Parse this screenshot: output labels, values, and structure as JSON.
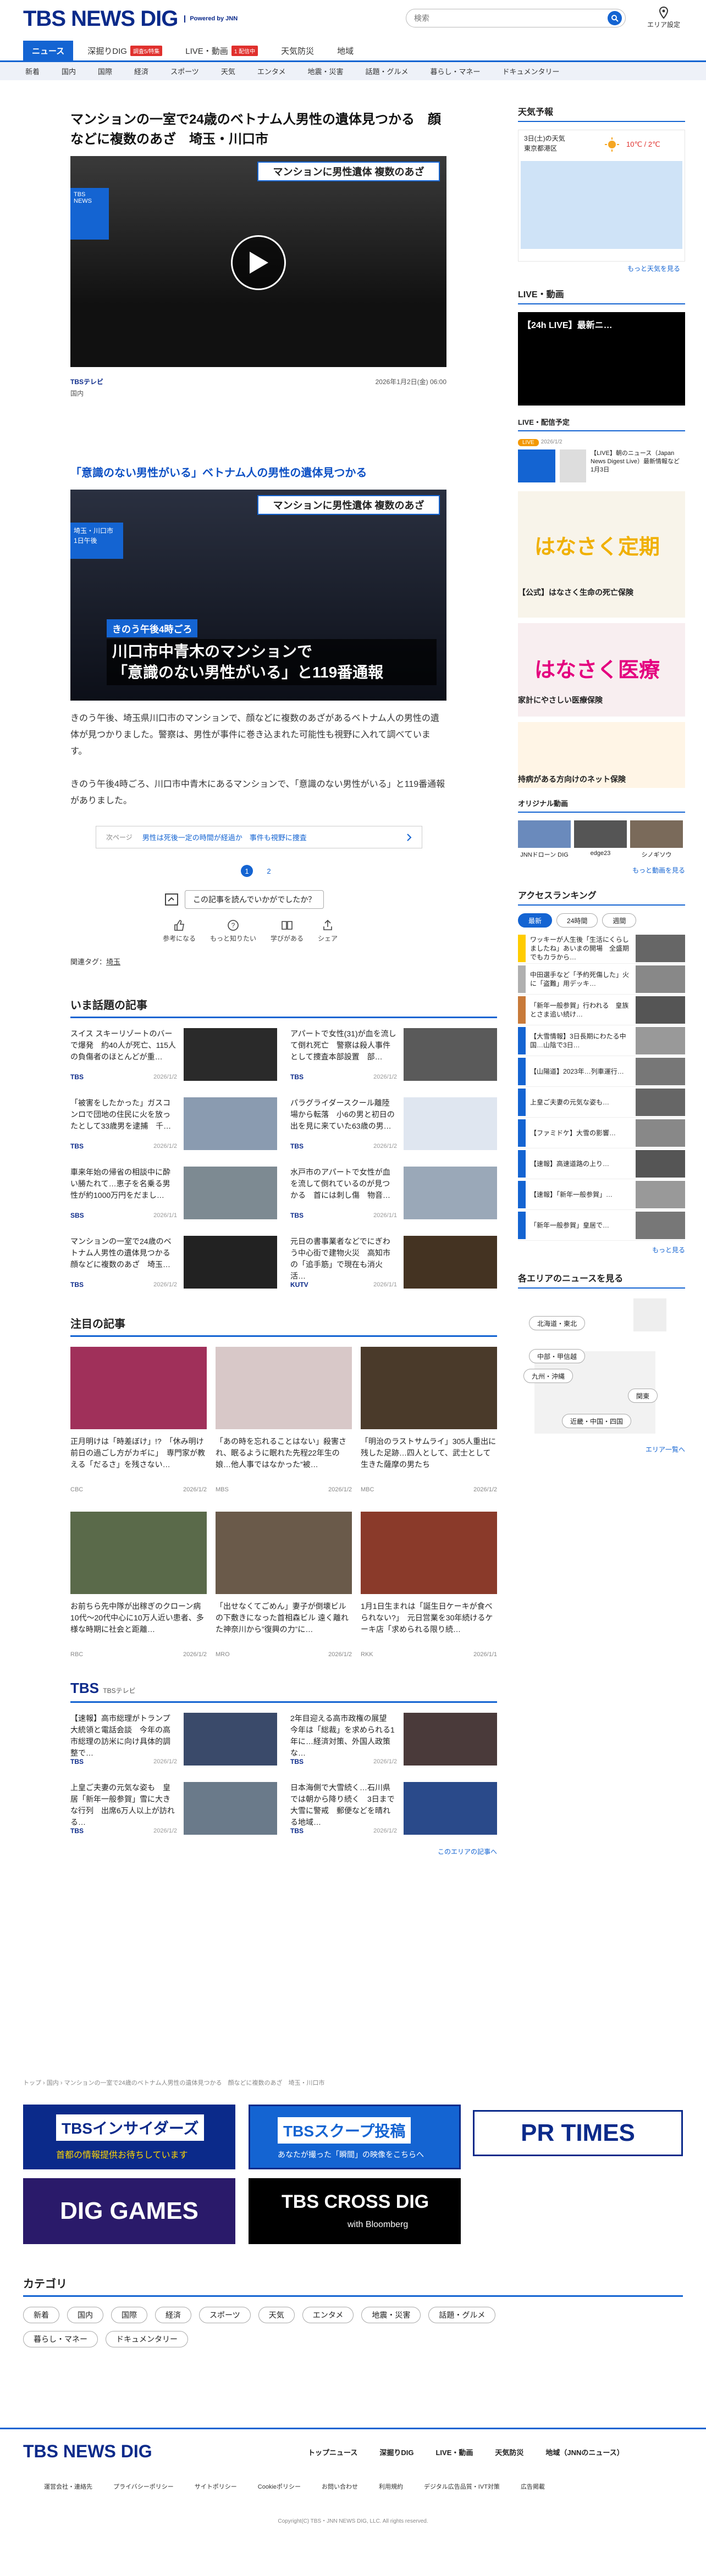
{
  "header": {
    "logo": "TBS NEWS DIG",
    "powered": "Powered by JNN",
    "search_placeholder": "検索",
    "area_label": "エリア設定"
  },
  "nav1": [
    {
      "label": "ニュース",
      "active": true
    },
    {
      "label": "深掘りDIG",
      "badge": "調査5/特集"
    },
    {
      "label": "LIVE・動画",
      "badge": "1 配信中"
    },
    {
      "label": "天気防災"
    },
    {
      "label": "地域"
    }
  ],
  "nav2": [
    "新着",
    "国内",
    "国際",
    "経済",
    "スポーツ",
    "天気",
    "エンタメ",
    "地震・災害",
    "話題・グルメ",
    "暮らし・マネー",
    "ドキュメンタリー"
  ],
  "article": {
    "title": "マンションの一室で24歳のベトナム人男性の遺体見つかる　顔などに複数のあざ　埼玉・川口市",
    "video_caption": "マンションに男性遺体 複数のあざ",
    "source": "TBSテレビ",
    "date": "2026年1月2日(金) 06:00",
    "category": "国内",
    "subheading": "「意識のない男性がいる」ベトナム人の男性の遺体見つかる",
    "img_caption_top": "マンションに男性遺体 複数のあざ",
    "img_place": "埼玉・川口市",
    "img_time": "1日午後",
    "img_tag": "きのう午後4時ごろ",
    "img_big1": "川口市中青木のマンションで",
    "img_big2": "「意識のない男性がいる」と119番通報",
    "p1": "きのう午後、埼玉県川口市のマンションで、顔などに複数のあざがあるベトナム人の男性の遺体が見つかりました。警察は、男性が事件に巻き込まれた可能性も視野に入れて調べています。",
    "p2": "きのう午後4時ごろ、川口市中青木にあるマンションで、「意識のない男性がいる」と119番通報がありました。",
    "next_label": "次ページ",
    "next_text": "男性は死後一定の時間が経過か　事件も視野に捜査",
    "page1": "1",
    "page2": "2",
    "feedback_q": "この記事を読んでいかがでしたか？",
    "reactions": [
      "参考になる",
      "もっと知りたい",
      "学びがある",
      "シェア"
    ],
    "tags_label": "関連タグ：",
    "tag": "埼玉"
  },
  "topics": {
    "heading": "いま話題の記事",
    "items": [
      {
        "title": "スイス スキーリゾートのバーで爆発　約40人が死亡、115人の負傷者のほとんどが重…",
        "src": "TBS",
        "date": "2026/1/2"
      },
      {
        "title": "アパートで女性(31)が血を流して倒れ死亡　警察は殺人事件として捜査本部設置　部…",
        "src": "TBS",
        "date": "2026/1/2"
      },
      {
        "title": "「被害をしたかった」ガスコンロで団地の住民に火を放ったとして33歳男を逮捕　千…",
        "src": "TBS",
        "date": "2026/1/2"
      },
      {
        "title": "パラグライダースクール離陸場から転落　小6の男と初日の出を見に来ていた63歳の男…",
        "src": "TBS",
        "date": "2026/1/2"
      },
      {
        "title": "車来年始の帰省の相談中に酔い勝たれて…恵子を名乗る男性が約1000万円をだまし…",
        "src": "SBS",
        "date": "2026/1/1"
      },
      {
        "title": "水戸市のアパートで女性が血を流して倒れているのが見つかる　首には刺し傷　物音…",
        "src": "TBS",
        "date": "2026/1/1"
      },
      {
        "title": "マンションの一室で24歳のベトナム人男性の遺体見つかる　顔などに複数のあざ　埼玉…",
        "src": "TBS",
        "date": "2026/1/2"
      },
      {
        "title": "元日の書事業者などでにぎわう中心街で建物火災　高知市の「追手筋」で現在も消火活…",
        "src": "KUTV",
        "date": "2026/1/1"
      }
    ]
  },
  "featured": {
    "heading": "注目の記事",
    "items": [
      {
        "title": "正月明けは「時差ぼけ」!?　「休み明け前日の過ごし方がカギに」　専門家が教える「だるさ」を残さない…",
        "src": "CBC",
        "date": "2026/1/2"
      },
      {
        "title": "「あの時を忘れることはない」殺害され、眠るように眠れた先程22年生の娘…他人事ではなかった”被…",
        "src": "MBS",
        "date": "2026/1/2"
      },
      {
        "title": "「明治のラストサムライ」305人重出に残した足跡…四人として、武士として生きた薩摩の男たち",
        "src": "MBC",
        "date": "2026/1/2"
      },
      {
        "title": "お前ちら先中隊が出稼ぎのクローン病 10代〜20代中心に10万人近い患者、多様な時期に社会と距離…",
        "src": "RBC",
        "date": "2026/1/2"
      },
      {
        "title": "「出せなくてごめん」妻子が倒壊ビルの下敷きになった首相森ビル 遠く離れた神奈川から”復興の力”に…",
        "src": "MRO",
        "date": "2026/1/2"
      },
      {
        "title": "1月1日生まれは「誕生日ケーキが食べられない?」　元日営業を30年続けるケーキ店「求められる限り続…",
        "src": "RKK",
        "date": "2026/1/1"
      }
    ]
  },
  "tbs": {
    "heading": "TBS",
    "sub": "TBSテレビ",
    "items": [
      {
        "title": "【速報】高市総理がトランプ大統領と電話会談　今年の高市総理の訪米に向け具体的調整で…",
        "src": "TBS",
        "date": "2026/1/2"
      },
      {
        "title": "2年目迎える高市政権の展望　今年は「総裁」を求められる1年に…経済対策、外国人政策な…",
        "src": "TBS",
        "date": "2026/1/2"
      },
      {
        "title": "上皇ご夫妻の元気な姿も　皇居「新年一般参賀」雪に大きな行列　出席6万人以上が訪れる…",
        "src": "TBS",
        "date": "2026/1/2"
      },
      {
        "title": "日本海側で大雪続く…石川県では朝から降り続く　3日まで大雪に警戒　郵便などを晴れる地域…",
        "src": "TBS",
        "date": "2026/1/2"
      }
    ],
    "more": "このエリアの記事へ"
  },
  "breadcrumb": "トップ › 国内 › マンションの一室で24歳のベトナム人男性の遺体見つかる　顔などに複数のあざ　埼玉・川口市",
  "banners": {
    "insiders": "TBSインサイダーズ",
    "insiders_sub": "首都の情報提供お待ちしています",
    "scoop": "TBSスクープ投稿",
    "scoop_sub": "あなたが撮った「瞬間」の映像をこちらへ",
    "prtimes": "PR TIMES",
    "game": "DIG GAMES",
    "cross": "TBS CROSS DIG",
    "cross_sub": "with Bloomberg"
  },
  "category": {
    "heading": "カテゴリ",
    "pills": [
      "新着",
      "国内",
      "国際",
      "経済",
      "スポーツ",
      "天気",
      "エンタメ",
      "地震・災害",
      "話題・グルメ",
      "暮らし・マネー",
      "ドキュメンタリー"
    ]
  },
  "side": {
    "weather_h": "天気予報",
    "weather_date": "3日(土)の天気",
    "weather_city": "東京都港区",
    "weather_temp": "10℃ / 2℃",
    "weather_more": "もっと天気を見る",
    "live_h": "LIVE・動画",
    "live_title": "【24h LIVE】最新ニ…",
    "schedule_h": "LIVE・配信予定",
    "schedule_tag": "LIVE",
    "schedule_date": "2026/1/2",
    "schedule_text": "【LIVE】朝のニュース（Japan News Digest Live）最新情報など　1月3日",
    "ad1_title": "はなさく定期",
    "ad1_text": "【公式】はなさく生命の死亡保険",
    "ad2_title": "はなさく医療",
    "ad2_text": "家計にやさしい医療保険",
    "ad3_text": "持病がある方向けのネット保険",
    "orig_h": "オリジナル動画",
    "orig_items": [
      "JNNドローン DIG",
      "edge23",
      "シノギソウ"
    ],
    "orig_more": "もっと動画を見る",
    "rank_h": "アクセスランキング",
    "rank_tabs": [
      "最新",
      "24時間",
      "週間"
    ],
    "ranks": [
      "ワッキーが人生後「生活にくらしましたね」あいまの開場　全盛期でもカラから…",
      "中田選手など「予約死傷した」火に「盗難」用デッキ…",
      "「新年一般参賀」行われる　皇族とさま追い続け…",
      "【大雪情報】3日長期にわたる中国…山陰で3日…",
      "【山陽道】2023年…列車運行…",
      "上皇ご夫妻の元気な姿も…",
      "【ファミドケ】大雪の影響…",
      "【速報】高速道路の上り…",
      "【速報】「新年一般参賀」…",
      "「新年一般参賀」皇居で…"
    ],
    "rank_more": "もっと見る",
    "map_h": "各エリアのニュースを見る",
    "map_labels": [
      "北海道・東北",
      "中部・甲信越",
      "九州・沖縄",
      "関東",
      "近畿・中国・四国"
    ],
    "map_more": "エリア一覧へ"
  },
  "footer": {
    "logo": "TBS NEWS DIG",
    "links1": [
      "トップニュース",
      "深掘りDIG",
      "LIVE・動画",
      "天気防災",
      "地域（JNNのニュース）"
    ],
    "links2": [
      "運営会社・連絡先",
      "プライバシーポリシー",
      "サイトポリシー",
      "Cookieポリシー",
      "お問い合わせ",
      "利用規約",
      "デジタル広告品質・IVT対策",
      "広告掲載"
    ],
    "copyright": "Copyright(C) TBS・JNN NEWS DIG, LLC. All rights reserved."
  },
  "colors": {
    "accent": "#1464d2",
    "navy": "#0b2a8a"
  }
}
